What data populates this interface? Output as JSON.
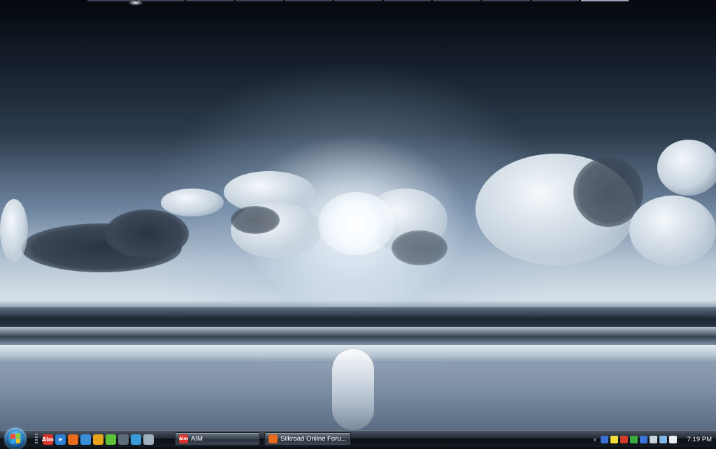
{
  "desktop": {
    "wallpaper": "ocean-sunburst-wallpaper"
  },
  "taskbar": {
    "start_button_icon": "windows-logo-icon",
    "quick_launch": [
      {
        "name": "aim-icon",
        "text": "Aim",
        "color": "#d9342b"
      },
      {
        "name": "internet-explorer-icon",
        "text": "e",
        "color": "#2d7fd3"
      },
      {
        "name": "firefox-icon",
        "text": "",
        "color": "#e66a1f"
      },
      {
        "name": "search-icon",
        "text": "",
        "color": "#3b8fd8"
      },
      {
        "name": "media-player-icon",
        "text": "",
        "color": "#e8a21c"
      },
      {
        "name": "green-app-icon",
        "text": "",
        "color": "#5cc23a"
      },
      {
        "name": "network-icon",
        "text": "",
        "color": "#5e6b78"
      },
      {
        "name": "globe-icon",
        "text": "",
        "color": "#3a9bd6"
      },
      {
        "name": "recycle-bin-icon",
        "text": "",
        "color": "#9fb0c0"
      }
    ],
    "tasks": [
      {
        "label": "AIM",
        "icon": "aim-icon",
        "icon_text": "Aim",
        "icon_color": "#d9342b"
      },
      {
        "label": "Silkroad Online Foru...",
        "icon": "firefox-icon",
        "icon_text": "",
        "icon_color": "#e66a1f"
      }
    ],
    "tray": {
      "expand_icon": "‹",
      "icons": [
        {
          "name": "zonealarm-icon",
          "color": "#3c6fd8"
        },
        {
          "name": "notes-icon",
          "color": "#f3df3b"
        },
        {
          "name": "app-icon-red",
          "color": "#d43a2a"
        },
        {
          "name": "app-icon-green",
          "color": "#3aaa3c"
        },
        {
          "name": "app-icon-blue",
          "color": "#3a74d8"
        },
        {
          "name": "device-icon",
          "color": "#c8d2dc"
        },
        {
          "name": "network-tray-icon",
          "color": "#7fb6e6"
        },
        {
          "name": "volume-icon",
          "color": "#e9eef3"
        }
      ],
      "clock": "7:19 PM"
    }
  }
}
